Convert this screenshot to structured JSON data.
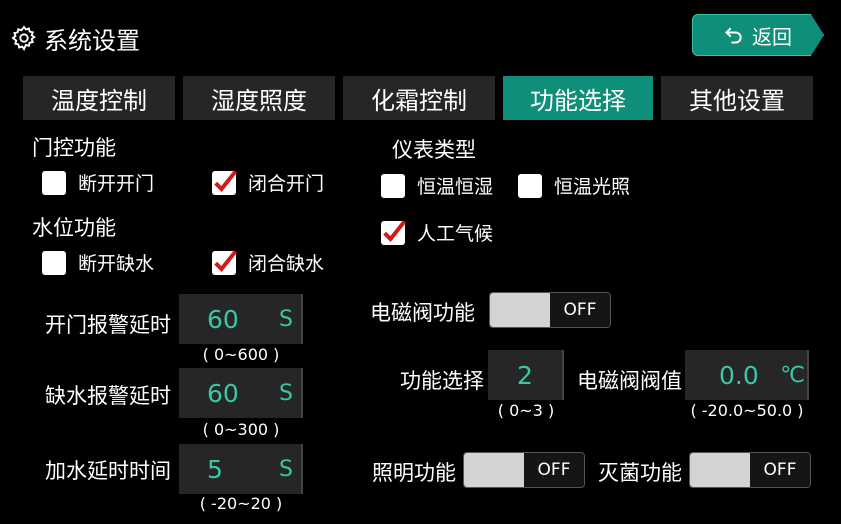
{
  "header": {
    "title": "系统设置",
    "back_label": "返回"
  },
  "tabs": [
    {
      "label": "温度控制",
      "active": false
    },
    {
      "label": "湿度照度",
      "active": false
    },
    {
      "label": "化霜控制",
      "active": false
    },
    {
      "label": "功能选择",
      "active": true
    },
    {
      "label": "其他设置",
      "active": false
    }
  ],
  "door": {
    "title": "门控功能",
    "options": [
      {
        "label": "断开开门",
        "checked": false
      },
      {
        "label": "闭合开门",
        "checked": true
      }
    ]
  },
  "water": {
    "title": "水位功能",
    "options": [
      {
        "label": "断开缺水",
        "checked": false
      },
      {
        "label": "闭合缺水",
        "checked": true
      }
    ]
  },
  "meter": {
    "title": "仪表类型",
    "options": [
      {
        "label": "恒温恒湿",
        "checked": false
      },
      {
        "label": "恒温光照",
        "checked": false
      },
      {
        "label": "人工气候",
        "checked": true
      }
    ]
  },
  "fields": {
    "door_alarm": {
      "label": "开门报警延时",
      "value": "60",
      "unit": "S",
      "range": "( 0~600 )"
    },
    "water_alarm": {
      "label": "缺水报警延时",
      "value": "60",
      "unit": "S",
      "range": "( 0~300 )"
    },
    "water_delay": {
      "label": "加水延时时间",
      "value": "5",
      "unit": "S",
      "range": "( -20~20 )"
    },
    "func_select": {
      "label": "功能选择",
      "value": "2",
      "range": "( 0~3 )"
    },
    "valve_threshold": {
      "label": "电磁阀阀值",
      "value": "0.0",
      "unit": "℃",
      "range": "( -20.0~50.0 )"
    }
  },
  "toggles": {
    "valve": {
      "label": "电磁阀功能",
      "state": "OFF"
    },
    "light": {
      "label": "照明功能",
      "state": "OFF"
    },
    "sterilize": {
      "label": "灭菌功能",
      "state": "OFF"
    }
  },
  "colors": {
    "accent": "#0f8f7a",
    "value_text": "#39c7a4",
    "check": "#d11a1a"
  }
}
